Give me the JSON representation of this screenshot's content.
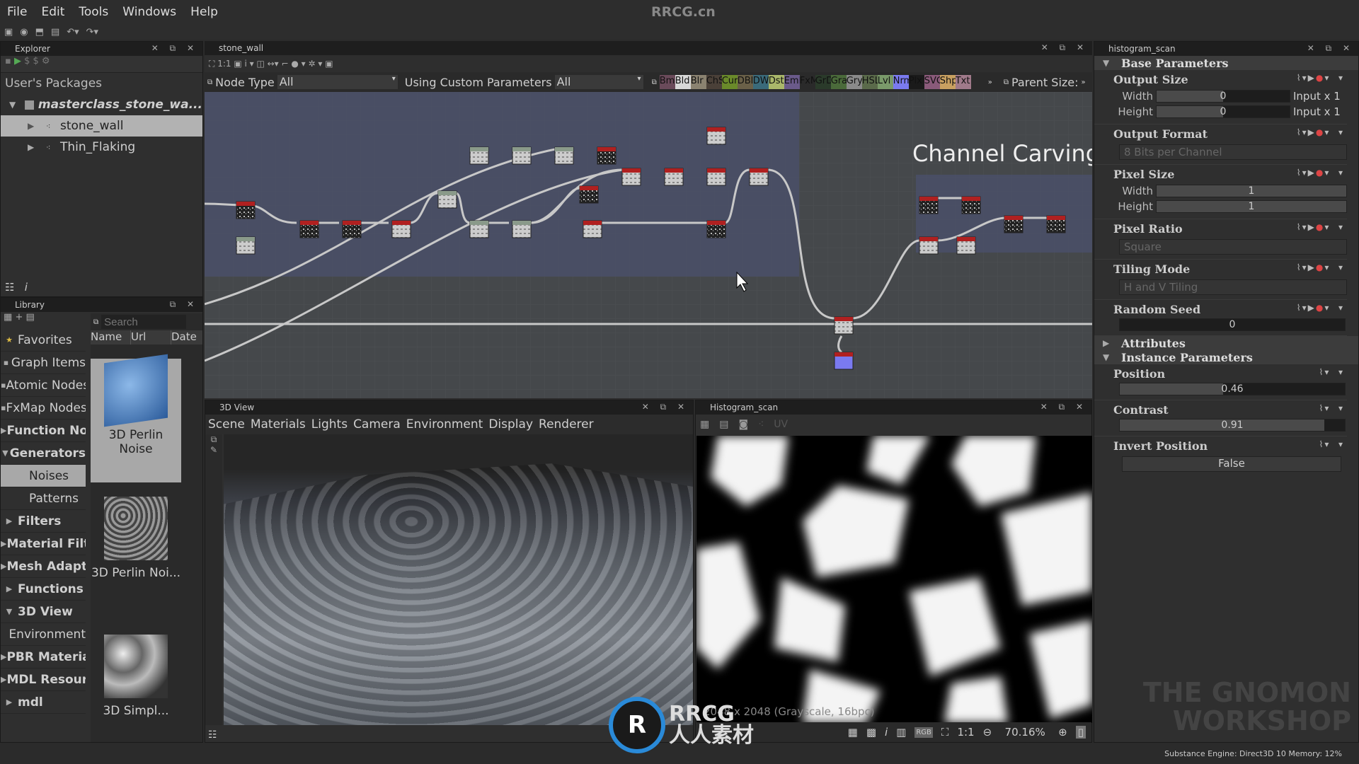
{
  "menu": {
    "items": [
      "File",
      "Edit",
      "Tools",
      "Windows",
      "Help"
    ],
    "watermark": "RRCG.cn"
  },
  "explorer": {
    "title": "Explorer",
    "root_label": "User's Packages",
    "package": "masterclass_stone_wa...",
    "graphs": [
      "stone_wall",
      "Thin_Flaking"
    ],
    "selected": "stone_wall"
  },
  "library": {
    "title": "Library",
    "search_placeholder": "Search",
    "columns": [
      "Name",
      "Url",
      "Date"
    ],
    "categories": [
      {
        "label": "Favorites",
        "bold": false,
        "icon": "star-icon"
      },
      {
        "label": "Graph Items",
        "bold": false,
        "icon": "comment-icon"
      },
      {
        "label": "Atomic Nodes",
        "bold": false,
        "icon": "atomic-icon"
      },
      {
        "label": "FxMap Nodes",
        "bold": false,
        "icon": "fxmap-icon"
      },
      {
        "label": "Function Nodes",
        "bold": true,
        "arrow": "▶"
      },
      {
        "label": "Generators",
        "bold": true,
        "arrow": "▼"
      },
      {
        "label": "Noises",
        "bold": false,
        "sub": true,
        "selected": true
      },
      {
        "label": "Patterns",
        "bold": false,
        "sub": true
      },
      {
        "label": "Filters",
        "bold": true,
        "arrow": "▶"
      },
      {
        "label": "Material Filters",
        "bold": true,
        "arrow": "▶"
      },
      {
        "label": "Mesh Adaptive",
        "bold": true,
        "arrow": "▶"
      },
      {
        "label": "Functions",
        "bold": true,
        "arrow": "▶"
      },
      {
        "label": "3D View",
        "bold": true,
        "arrow": "▼"
      },
      {
        "label": "Environment",
        "bold": false,
        "sub": true
      },
      {
        "label": "PBR Materials",
        "bold": true,
        "arrow": "▶"
      },
      {
        "label": "MDL Resources",
        "bold": true,
        "arrow": "▶"
      },
      {
        "label": "mdl",
        "bold": true,
        "arrow": "▶"
      }
    ],
    "thumbnails": [
      "3D Perlin Noise",
      "3D Perlin Noi...",
      "3D Simpl..."
    ]
  },
  "graph": {
    "title": "stone_wall",
    "node_type_label": "Node Type",
    "node_type_value": "All",
    "custom_params_label": "Using Custom Parameters",
    "custom_params_value": "All",
    "parent_size_label": "Parent Size:",
    "frame_title": "Channel Carving",
    "node_buttons": [
      {
        "t": "Bmp",
        "c": "#6a4a5a"
      },
      {
        "t": "Bld",
        "c": "#d8d8d8"
      },
      {
        "t": "Blr",
        "c": "#8a8270"
      },
      {
        "t": "ChS",
        "c": "#4a4038"
      },
      {
        "t": "Cur",
        "c": "#6a8a2a"
      },
      {
        "t": "DBl",
        "c": "#6a6048"
      },
      {
        "t": "DWr",
        "c": "#3a6a7a"
      },
      {
        "t": "Dst",
        "c": "#aab86a"
      },
      {
        "t": "Emb",
        "c": "#6a5a8a"
      },
      {
        "t": "FxM",
        "c": "#2a2a2a"
      },
      {
        "t": "GrD",
        "c": "#2a3a2a"
      },
      {
        "t": "Gra",
        "c": "#4a6a3a"
      },
      {
        "t": "Gry",
        "c": "#8a8a8a"
      },
      {
        "t": "HSL",
        "c": "#5a6a4a"
      },
      {
        "t": "Lvl",
        "c": "#7a9a6a"
      },
      {
        "t": "Nrm",
        "c": "#7a7af0"
      },
      {
        "t": "Plx",
        "c": "#1a1a1a"
      },
      {
        "t": "SVG",
        "c": "#8a5a7a"
      },
      {
        "t": "Shp",
        "c": "#c8a060"
      },
      {
        "t": "Txt",
        "c": "#a07a8a"
      }
    ]
  },
  "view3d": {
    "title": "3D View",
    "menu": [
      "Scene",
      "Materials",
      "Lights",
      "Camera",
      "Environment",
      "Display",
      "Renderer"
    ]
  },
  "view2d": {
    "title": "Histogram_scan",
    "uv_label": "UV",
    "info": "2048 x 2048 (Grayscale, 16bpc)",
    "zoom": "70.16%",
    "ratio_label": "1:1"
  },
  "props": {
    "title": "histogram_scan",
    "base_section": "Base Parameters",
    "output_size": {
      "label": "Output Size",
      "width_label": "Width",
      "width": "0",
      "width_suffix": "Input x 1",
      "height_label": "Height",
      "height": "0",
      "height_suffix": "Input x 1"
    },
    "output_format": {
      "label": "Output Format",
      "value": "8 Bits per Channel"
    },
    "pixel_size": {
      "label": "Pixel Size",
      "width_label": "Width",
      "width": "1",
      "height_label": "Height",
      "height": "1"
    },
    "pixel_ratio": {
      "label": "Pixel Ratio",
      "value": "Square"
    },
    "tiling_mode": {
      "label": "Tiling Mode",
      "value": "H and V Tiling"
    },
    "random_seed": {
      "label": "Random Seed",
      "value": "0"
    },
    "attributes_section": "Attributes",
    "instance_section": "Instance Parameters",
    "position": {
      "label": "Position",
      "value": "0.46",
      "fraction": 0.46
    },
    "contrast": {
      "label": "Contrast",
      "value": "0.91",
      "fraction": 0.91
    },
    "invert_position": {
      "label": "Invert Position",
      "value": "False"
    }
  },
  "status": {
    "engine": "Substance Engine: Direct3D 10  Memory: 12%"
  },
  "branding": {
    "logo": "THE GNOMON WORKSHOP",
    "rrcg": "RRCG 人人素材"
  }
}
